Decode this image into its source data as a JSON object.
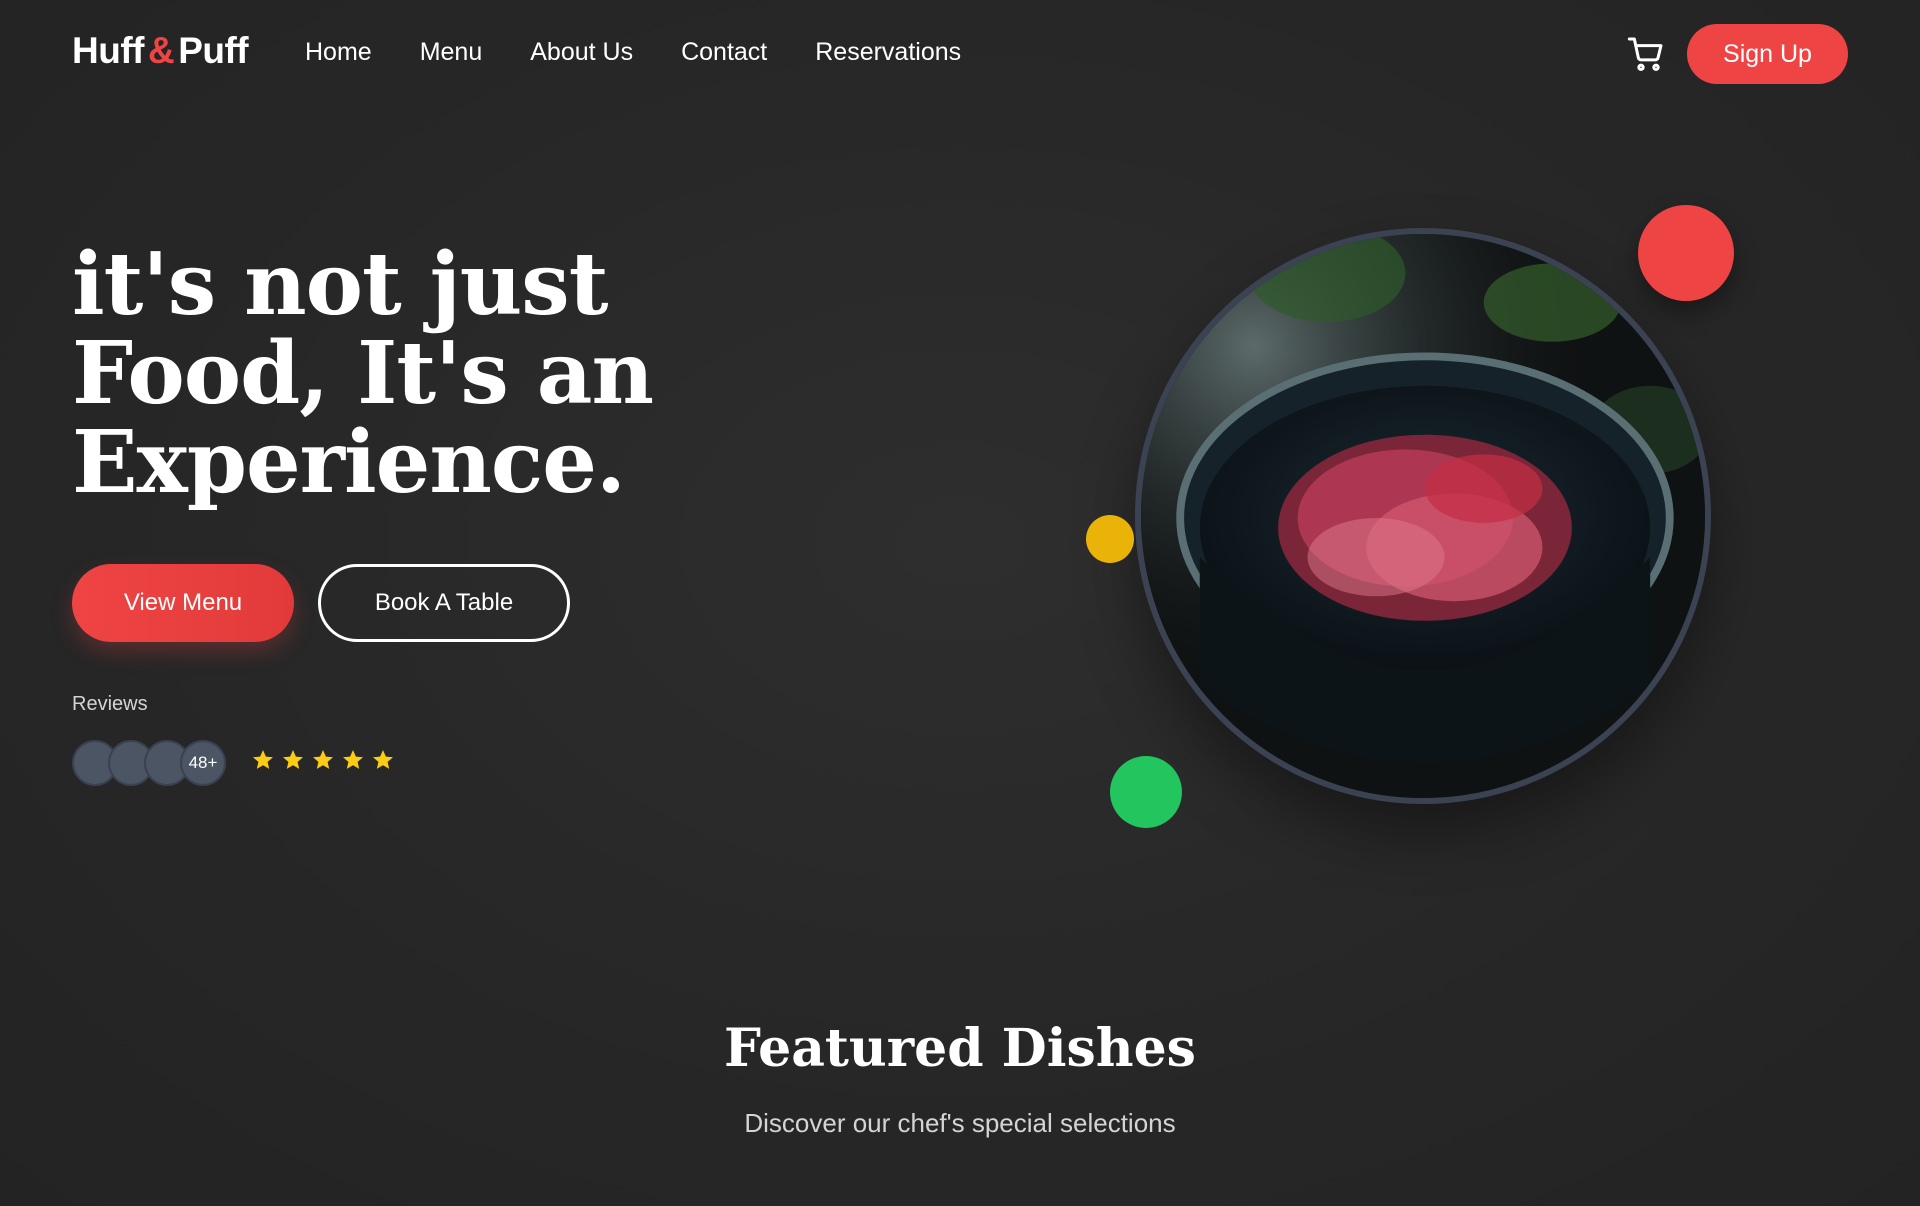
{
  "brand": {
    "name_part1": "Huff",
    "amp": "&",
    "name_part2": "Puff"
  },
  "nav": {
    "links": [
      "Home",
      "Menu",
      "About Us",
      "Contact",
      "Reservations"
    ],
    "cart_icon": "cart-icon",
    "signup_label": "Sign Up"
  },
  "hero": {
    "title_line1": "it's not just",
    "title_line2": "Food, It's an",
    "title_line3": "Experience.",
    "view_menu_label": "View Menu",
    "book_table_label": "Book A Table",
    "reviews_label": "Reviews",
    "reviews_count": "48+",
    "star_rating": 5,
    "image_icon": "food-bowl-image"
  },
  "featured": {
    "title": "Featured Dishes",
    "subtitle": "Discover our chef's special selections"
  },
  "colors": {
    "accent": "#ef4444",
    "yellow": "#eab308",
    "green": "#22c55e",
    "star": "#facc15",
    "background": "#272727"
  }
}
